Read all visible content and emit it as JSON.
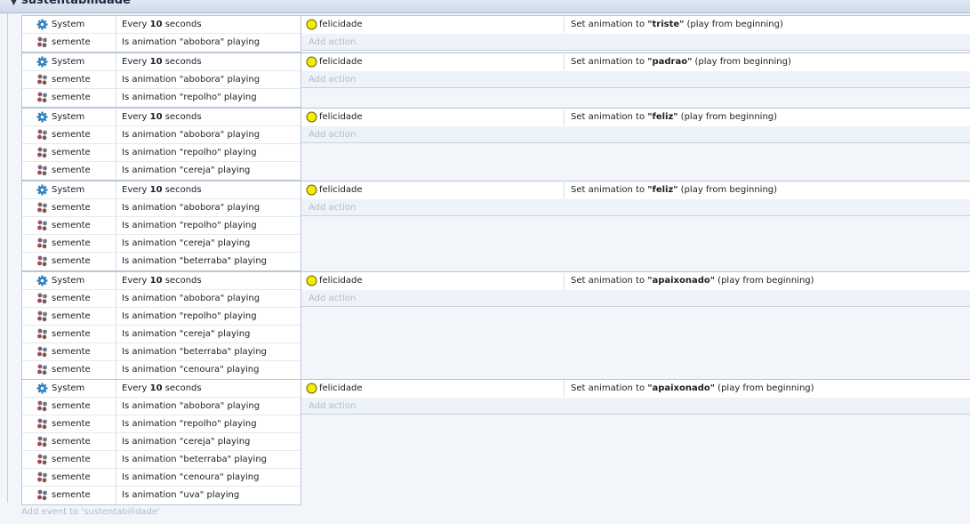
{
  "group": {
    "title": "sustentabilidade",
    "add_event_label": "Add event to 'sustentabilidade'"
  },
  "labels": {
    "add_action": "Add action"
  },
  "events": [
    {
      "conditions": [
        {
          "object": "System",
          "icon": "gear-icon",
          "pre": "Every ",
          "bold": "10",
          "post": " seconds"
        },
        {
          "object": "semente",
          "icon": "sprite-icon",
          "pre": "Is animation \"abobora\" playing",
          "bold": "",
          "post": ""
        }
      ],
      "action": {
        "object": "felicidade",
        "icon": "circle-sprite-icon",
        "pre": "Set animation to ",
        "bold": "\"triste\"",
        "post": " (play from beginning)"
      }
    },
    {
      "conditions": [
        {
          "object": "System",
          "icon": "gear-icon",
          "pre": "Every ",
          "bold": "10",
          "post": " seconds"
        },
        {
          "object": "semente",
          "icon": "sprite-icon",
          "pre": "Is animation \"abobora\" playing",
          "bold": "",
          "post": ""
        },
        {
          "object": "semente",
          "icon": "sprite-icon",
          "pre": "Is animation \"repolho\" playing",
          "bold": "",
          "post": ""
        }
      ],
      "action": {
        "object": "felicidade",
        "icon": "circle-sprite-icon",
        "pre": "Set animation to ",
        "bold": "\"padrao\"",
        "post": " (play from beginning)"
      }
    },
    {
      "conditions": [
        {
          "object": "System",
          "icon": "gear-icon",
          "pre": "Every ",
          "bold": "10",
          "post": " seconds"
        },
        {
          "object": "semente",
          "icon": "sprite-icon",
          "pre": "Is animation \"abobora\" playing",
          "bold": "",
          "post": ""
        },
        {
          "object": "semente",
          "icon": "sprite-icon",
          "pre": "Is animation \"repolho\" playing",
          "bold": "",
          "post": ""
        },
        {
          "object": "semente",
          "icon": "sprite-icon",
          "pre": "Is animation \"cereja\" playing",
          "bold": "",
          "post": ""
        }
      ],
      "action": {
        "object": "felicidade",
        "icon": "circle-sprite-icon",
        "pre": "Set animation to ",
        "bold": "\"feliz\"",
        "post": " (play from beginning)"
      }
    },
    {
      "conditions": [
        {
          "object": "System",
          "icon": "gear-icon",
          "pre": "Every ",
          "bold": "10",
          "post": " seconds"
        },
        {
          "object": "semente",
          "icon": "sprite-icon",
          "pre": "Is animation \"abobora\" playing",
          "bold": "",
          "post": ""
        },
        {
          "object": "semente",
          "icon": "sprite-icon",
          "pre": "Is animation \"repolho\" playing",
          "bold": "",
          "post": ""
        },
        {
          "object": "semente",
          "icon": "sprite-icon",
          "pre": "Is animation \"cereja\" playing",
          "bold": "",
          "post": ""
        },
        {
          "object": "semente",
          "icon": "sprite-icon",
          "pre": "Is animation \"beterraba\" playing",
          "bold": "",
          "post": ""
        }
      ],
      "action": {
        "object": "felicidade",
        "icon": "circle-sprite-icon",
        "pre": "Set animation to ",
        "bold": "\"feliz\"",
        "post": " (play from beginning)"
      }
    },
    {
      "conditions": [
        {
          "object": "System",
          "icon": "gear-icon",
          "pre": "Every ",
          "bold": "10",
          "post": " seconds"
        },
        {
          "object": "semente",
          "icon": "sprite-icon",
          "pre": "Is animation \"abobora\" playing",
          "bold": "",
          "post": ""
        },
        {
          "object": "semente",
          "icon": "sprite-icon",
          "pre": "Is animation \"repolho\" playing",
          "bold": "",
          "post": ""
        },
        {
          "object": "semente",
          "icon": "sprite-icon",
          "pre": "Is animation \"cereja\" playing",
          "bold": "",
          "post": ""
        },
        {
          "object": "semente",
          "icon": "sprite-icon",
          "pre": "Is animation \"beterraba\" playing",
          "bold": "",
          "post": ""
        },
        {
          "object": "semente",
          "icon": "sprite-icon",
          "pre": "Is animation \"cenoura\" playing",
          "bold": "",
          "post": ""
        }
      ],
      "action": {
        "object": "felicidade",
        "icon": "circle-sprite-icon",
        "pre": "Set animation to ",
        "bold": "\"apaixonado\"",
        "post": " (play from beginning)"
      }
    },
    {
      "conditions": [
        {
          "object": "System",
          "icon": "gear-icon",
          "pre": "Every ",
          "bold": "10",
          "post": " seconds"
        },
        {
          "object": "semente",
          "icon": "sprite-icon",
          "pre": "Is animation \"abobora\" playing",
          "bold": "",
          "post": ""
        },
        {
          "object": "semente",
          "icon": "sprite-icon",
          "pre": "Is animation \"repolho\" playing",
          "bold": "",
          "post": ""
        },
        {
          "object": "semente",
          "icon": "sprite-icon",
          "pre": "Is animation \"cereja\" playing",
          "bold": "",
          "post": ""
        },
        {
          "object": "semente",
          "icon": "sprite-icon",
          "pre": "Is animation \"beterraba\" playing",
          "bold": "",
          "post": ""
        },
        {
          "object": "semente",
          "icon": "sprite-icon",
          "pre": "Is animation \"cenoura\" playing",
          "bold": "",
          "post": ""
        },
        {
          "object": "semente",
          "icon": "sprite-icon",
          "pre": "Is animation \"uva\" playing",
          "bold": "",
          "post": ""
        }
      ],
      "action": {
        "object": "felicidade",
        "icon": "circle-sprite-icon",
        "pre": "Set animation to ",
        "bold": "\"apaixonado\"",
        "post": " (play from beginning)"
      }
    }
  ]
}
